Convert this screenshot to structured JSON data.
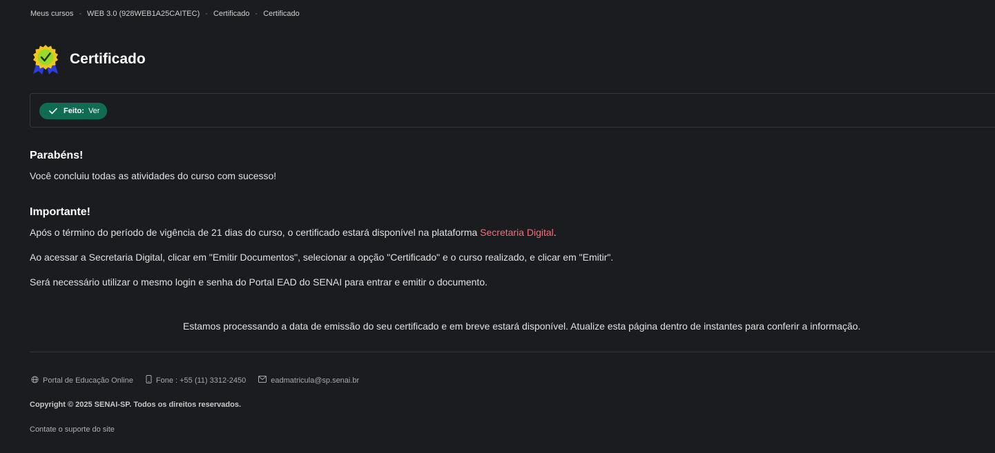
{
  "breadcrumb": {
    "items": [
      "Meus cursos",
      "WEB 3.0 (928WEB1A25CAITEC)",
      "Certificado",
      "Certificado"
    ],
    "separator": "-"
  },
  "header": {
    "title": "Certificado",
    "icon": "award-badge-icon"
  },
  "completion": {
    "label": "Feito:",
    "value": "Ver"
  },
  "congrats": {
    "heading": "Parabéns!",
    "text": "Você concluiu todas as atividades do curso com sucesso!"
  },
  "important": {
    "heading": "Importante!",
    "p1_before": "Após o término do período de vigência de 21 dias do curso, o certificado estará disponível na plataforma ",
    "p1_link": "Secretaria Digital",
    "p1_after": ".",
    "p2": "Ao acessar a Secretaria Digital, clicar em \"Emitir Documentos\", selecionar a opção \"Certificado\" e o curso realizado, e clicar em \"Emitir\".",
    "p3": "Será necessário utilizar o mesmo login e senha do Portal EAD do SENAI para entrar e emitir o documento."
  },
  "notice": "Estamos processando a data de emissão do seu certificado e em breve estará disponível. Atualize esta página dentro de instantes para conferir a informação.",
  "footer": {
    "portal": "Portal de Educação Online",
    "phone": "Fone : +55 (11) 3312-2450",
    "email": "eadmatricula@sp.senai.br",
    "copyright": "Copyright © 2025 SENAI-SP. Todos os direitos reservados.",
    "support": "Contate o suporte do site"
  },
  "colors": {
    "background": "#1b1c20",
    "status_green": "#0f6b52",
    "link": "#f0707a"
  }
}
